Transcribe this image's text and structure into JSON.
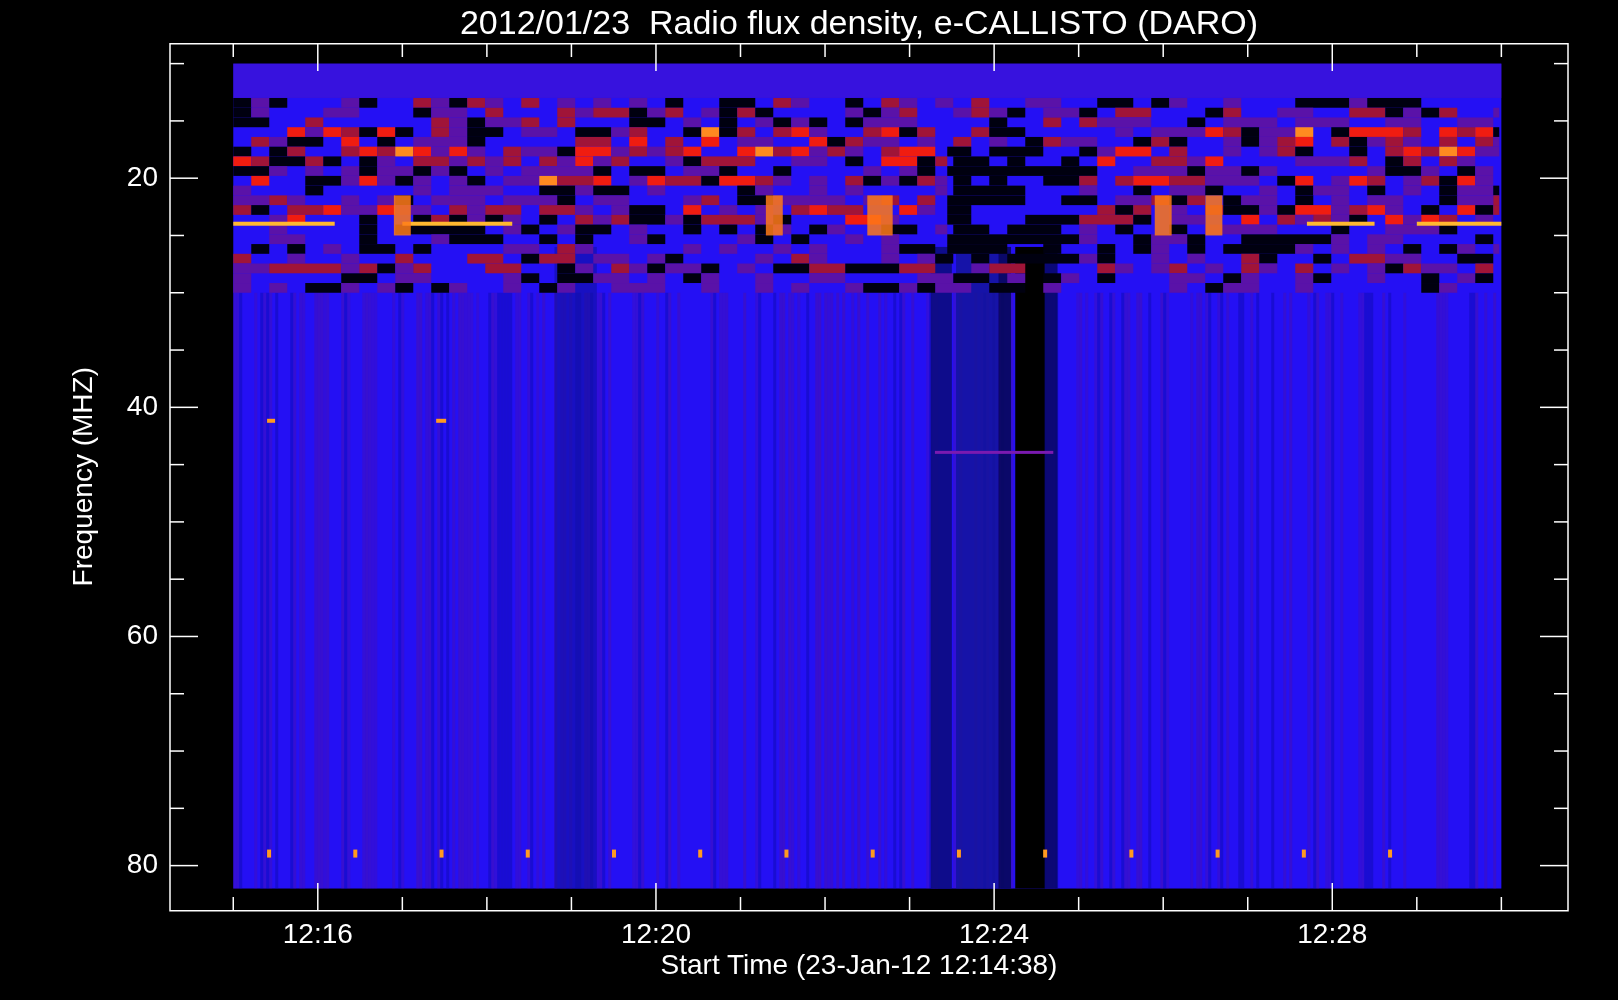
{
  "title": "2012/01/23  Radio flux density, e-CALLISTO (DARO)",
  "plot": {
    "x_axis": {
      "label": "Start Time (23-Jan-12 12:14:38)",
      "ticks": [
        "12:16",
        "12:20",
        "12:24",
        "12:28"
      ]
    },
    "y_axis": {
      "label": "Frequency (MHZ)",
      "ticks": [
        "20",
        "40",
        "60",
        "80"
      ]
    }
  }
}
